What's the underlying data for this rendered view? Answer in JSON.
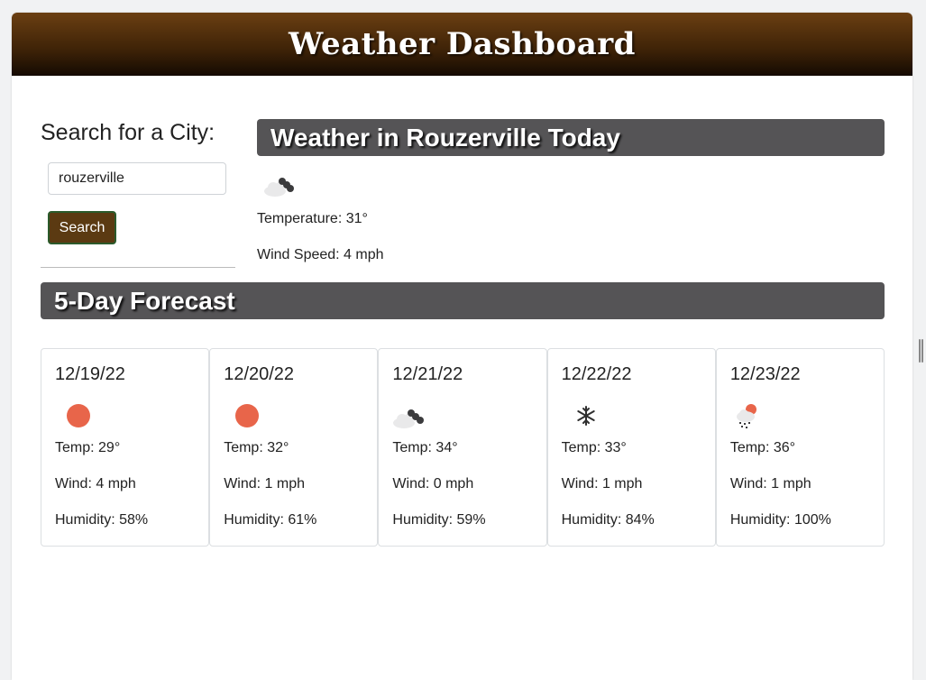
{
  "app": {
    "title": "Weather Dashboard"
  },
  "search": {
    "heading": "Search for a City:",
    "value": "rouzerville",
    "button_label": "Search"
  },
  "today": {
    "heading": "Weather in Rouzerville Today",
    "icon": "cloudy-night-icon",
    "temperature": "Temperature: 31°",
    "wind": "Wind Speed: 4 mph"
  },
  "forecast": {
    "heading": "5-Day Forecast",
    "days": [
      {
        "date": "12/19/22",
        "icon": "sun-icon",
        "temp": "Temp: 29°",
        "wind": "Wind: 4 mph",
        "humidity": "Humidity: 58%"
      },
      {
        "date": "12/20/22",
        "icon": "sun-icon",
        "temp": "Temp: 32°",
        "wind": "Wind: 1 mph",
        "humidity": "Humidity: 61%"
      },
      {
        "date": "12/21/22",
        "icon": "cloudy-night-icon",
        "temp": "Temp: 34°",
        "wind": "Wind: 0 mph",
        "humidity": "Humidity: 59%"
      },
      {
        "date": "12/22/22",
        "icon": "snowflake-icon",
        "temp": "Temp: 33°",
        "wind": "Wind: 1 mph",
        "humidity": "Humidity: 84%"
      },
      {
        "date": "12/23/22",
        "icon": "rain-cloud-sun-icon",
        "temp": "Temp: 36°",
        "wind": "Wind: 1 mph",
        "humidity": "Humidity: 100%"
      }
    ]
  },
  "colors": {
    "header_top": "#6b3f12",
    "header_bottom": "#140a02",
    "section_bar": "#555456",
    "button": "#5b3a12",
    "sun": "#e8654a"
  }
}
